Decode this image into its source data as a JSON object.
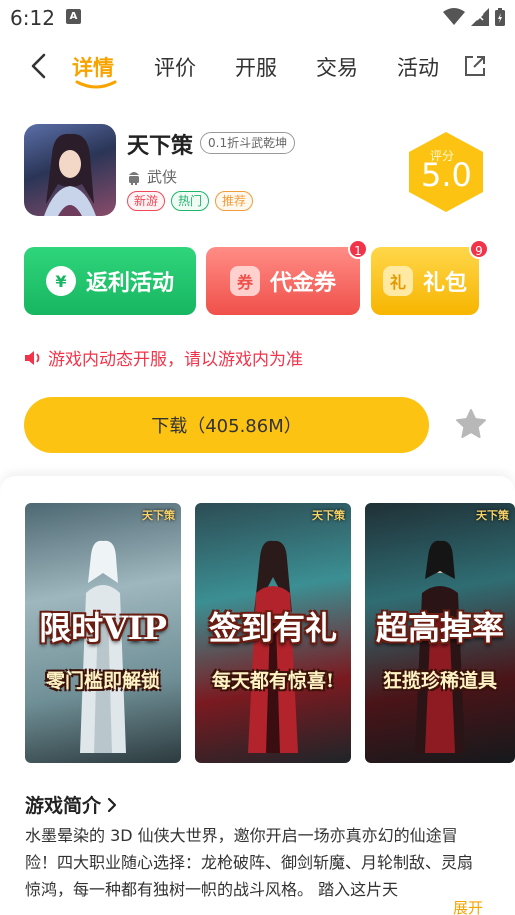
{
  "status_bar": {
    "time": "6:12",
    "notification_icon": "A"
  },
  "nav": {
    "tabs": [
      {
        "label": "详情",
        "active": true
      },
      {
        "label": "评价",
        "active": false
      },
      {
        "label": "开服",
        "active": false
      },
      {
        "label": "交易",
        "active": false
      },
      {
        "label": "活动",
        "active": false
      }
    ]
  },
  "game": {
    "title": "天下策",
    "discount_tag": "0.1折斗武乾坤",
    "platform": "武侠",
    "badges": [
      "新游",
      "热门",
      "推荐"
    ],
    "score_label": "评分",
    "score": "5.0"
  },
  "actions": {
    "rebate": {
      "label": "返利活动",
      "icon_glyph": "¥"
    },
    "voucher": {
      "label": "代金券",
      "badge_count": "1",
      "icon_glyph": "券"
    },
    "gift": {
      "label": "礼包",
      "badge_count": "9",
      "icon_glyph": "礼"
    }
  },
  "notice": "游戏内动态开服，请以游戏内为准",
  "download": {
    "label": "下载（405.86M）"
  },
  "banners": [
    {
      "logo": "天下策",
      "title": "限时VIP",
      "subtitle": "零门槛即解锁"
    },
    {
      "logo": "天下策",
      "title": "签到有礼",
      "subtitle": "每天都有惊喜!"
    },
    {
      "logo": "天下策",
      "title": "超高掉率",
      "subtitle": "狂揽珍稀道具"
    }
  ],
  "intro": {
    "title": "游戏简介",
    "text": "水墨晕染的 3D 仙侠大世界，邀你开启一场亦真亦幻的仙途冒险！四大职业随心选择：龙枪破阵、御剑斩魔、月轮制敌、灵扇惊鸿，每一种都有独树一帜的战斗风格。 踏入这片天",
    "expand_label": "展开"
  },
  "colors": {
    "accent": "#f7a400",
    "download": "#fcc312",
    "rebate": "#1ec56a",
    "voucher": "#f3605a",
    "gift": "#fbc21a",
    "notice": "#f2344a"
  }
}
